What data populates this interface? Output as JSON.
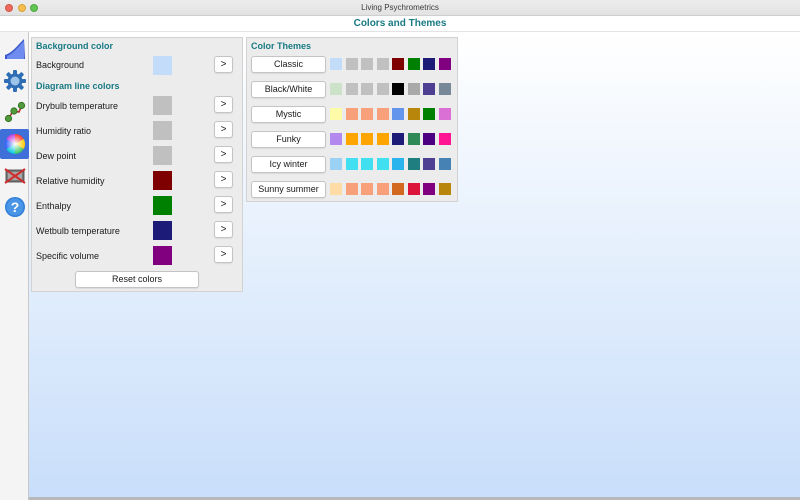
{
  "window": {
    "title": "Living Psychrometrics"
  },
  "header": {
    "title": "Colors and Themes"
  },
  "toolbar": {
    "tools": [
      {
        "icon": "chart-icon"
      },
      {
        "icon": "gear-icon"
      },
      {
        "icon": "process-icon"
      },
      {
        "icon": "color-wheel-icon",
        "active": true
      },
      {
        "icon": "equipment-icon"
      },
      {
        "icon": "help-icon"
      }
    ]
  },
  "colors": {
    "background_section": "Background color",
    "background_label": "Background",
    "background_color": "#c3dcfa",
    "lines_section": "Diagram line colors",
    "lines": [
      {
        "label": "Drybulb temperature",
        "color": "#c0c0c0"
      },
      {
        "label": "Humidity ratio",
        "color": "#c0c0c0"
      },
      {
        "label": "Dew point",
        "color": "#c0c0c0"
      },
      {
        "label": "Relative humidity",
        "color": "#7f0000"
      },
      {
        "label": "Enthalpy",
        "color": "#008000"
      },
      {
        "label": "Wetbulb temperature",
        "color": "#1c1c78"
      },
      {
        "label": "Specific volume",
        "color": "#800080"
      }
    ],
    "arrow_label": ">",
    "reset_label": "Reset colors"
  },
  "themes": {
    "title": "Color Themes",
    "items": [
      {
        "label": "Classic",
        "swatches": [
          "#c3dcfa",
          "#c0c0c0",
          "#c0c0c0",
          "#c0c0c0",
          "#7f0000",
          "#008000",
          "#1c1c78",
          "#800080"
        ]
      },
      {
        "label": "Black/White",
        "swatches": [
          "#cde3c9",
          "#c0c0c0",
          "#c0c0c0",
          "#c0c0c0",
          "#000000",
          "#a9a9a9",
          "#4f3f92",
          "#778899"
        ]
      },
      {
        "label": "Mystic",
        "swatches": [
          "#fefba8",
          "#f7a07a",
          "#f7a07a",
          "#f7a07a",
          "#6495ed",
          "#b8860b",
          "#008000",
          "#da70d6"
        ]
      },
      {
        "label": "Funky",
        "swatches": [
          "#b388ee",
          "#ffa500",
          "#ffa500",
          "#ffa500",
          "#1c1c78",
          "#2e8b57",
          "#4b0082",
          "#ff1493"
        ]
      },
      {
        "label": "Icy winter",
        "swatches": [
          "#9ad1f5",
          "#40e0f0",
          "#40e0f0",
          "#40e0f0",
          "#2ab4ee",
          "#1f7f80",
          "#4f3f92",
          "#4682b4"
        ]
      },
      {
        "label": "Sunny summer",
        "swatches": [
          "#fddca6",
          "#f7a07a",
          "#f7a07a",
          "#f7a07a",
          "#d2691e",
          "#dc143c",
          "#800080",
          "#b8860b"
        ]
      }
    ]
  }
}
